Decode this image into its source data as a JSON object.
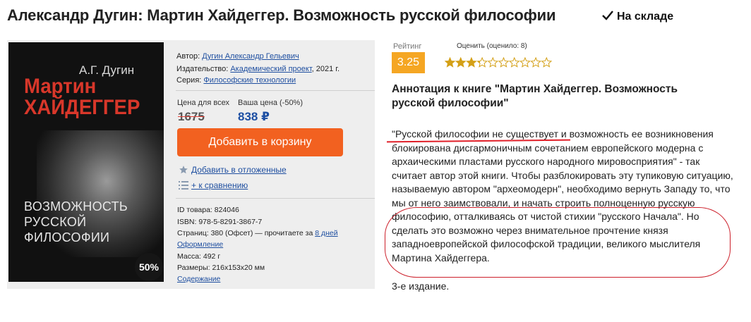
{
  "page": {
    "title": "Александр Дугин: Мартин Хайдеггер. Возможность русской философии",
    "stock_status": "На складе"
  },
  "cover": {
    "author": "А.Г. Дугин",
    "title_line1": "Мартин",
    "title_line2": "ХАЙДЕГГЕР",
    "subtitle_line1": "ВОЗМОЖНОСТЬ",
    "subtitle_line2": "РУССКОЙ",
    "subtitle_line3": "ФИЛОСОФИИ",
    "discount": "50%"
  },
  "details": {
    "author_label": "Автор:",
    "author_value": "Дугин Александр Гельевич",
    "publisher_label": "Издательство:",
    "publisher_value": "Академический проект",
    "publisher_year": ", 2021 г.",
    "series_label": "Серия:",
    "series_value": "Философские технологии"
  },
  "price": {
    "list_label": "Цена для всех",
    "your_label": "Ваша цена (-50%)",
    "old_price": "1675",
    "new_price": "838 ₽"
  },
  "actions": {
    "add_to_cart": "Добавить в корзину",
    "add_to_wishlist": "Добавить в отложенные",
    "add_to_compare": "+ к сравнению"
  },
  "specs": {
    "id": "ID товара: 824046",
    "isbn": "ISBN: 978-5-8291-3867-7",
    "pages_prefix": "Страниц: 380 (Офсет) — прочитаете за ",
    "pages_link": "8 дней",
    "design_link": "Оформление",
    "weight": "Масса: 492 г",
    "size": "Размеры: 216x153x20 мм",
    "contents_link": "Содержание"
  },
  "rating": {
    "label": "Рейтинг",
    "value": "3.25",
    "rate_label": "Оценить (оценило: 8)",
    "stars_total": 10,
    "stars_filled": 3.25,
    "star_color": "#d4a017"
  },
  "annotation": {
    "title": "Аннотация к книге \"Мартин Хайдеггер. Возможность русской философии\"",
    "text": "\"Русской философии не существует и возможность ее возникновения блокирована дисгармоничным сочетанием европейского модерна с архаическими пластами русского народного мировосприятия\" - так считает автор этой книги. Чтобы разблокировать эту тупиковую ситуацию, называемую автором \"археомодерн\", необходимо вернуть Западу то, что мы от него заимствовали, и начать строить полноценную русскую философию, отталкиваясь от чистой стихии \"русского Начала\". Но сделать это возможно через внимательное прочтение князя западноевропейской философской традиции, великого мыслителя Мартина Хайдеггера.",
    "edition": "3-е издание."
  },
  "colors": {
    "accent_orange": "#f26120",
    "rating_orange": "#f5a623",
    "link_blue": "#1f4fa0",
    "markup_red": "#e01f28"
  }
}
